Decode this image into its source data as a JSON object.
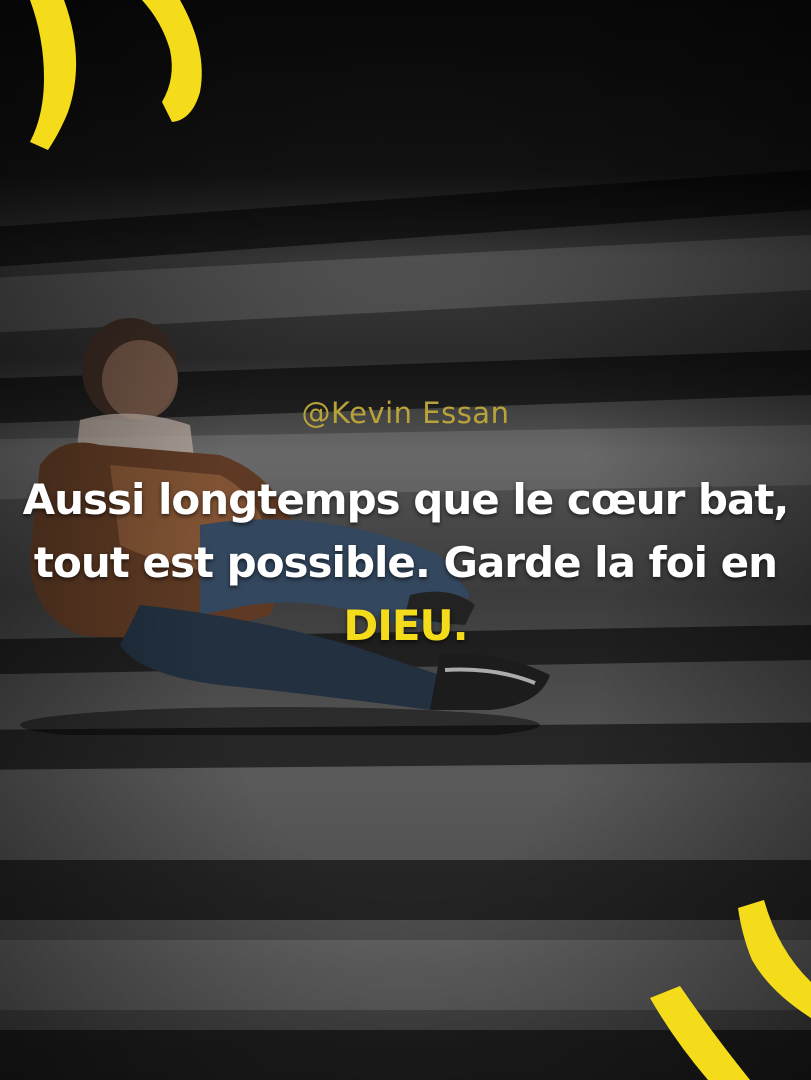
{
  "handle": "@Kevin Essan",
  "quote": {
    "text": "Aussi longtemps que le cœur bat, tout est possible. Garde la foi en ",
    "highlight": "DIEU."
  },
  "colors": {
    "accent": "#f5dc1a",
    "handle": "#b8a33a",
    "text": "#ffffff"
  },
  "icons": {
    "top_left": "opening-quote-marks-icon",
    "bottom_right": "closing-quote-marks-icon"
  }
}
